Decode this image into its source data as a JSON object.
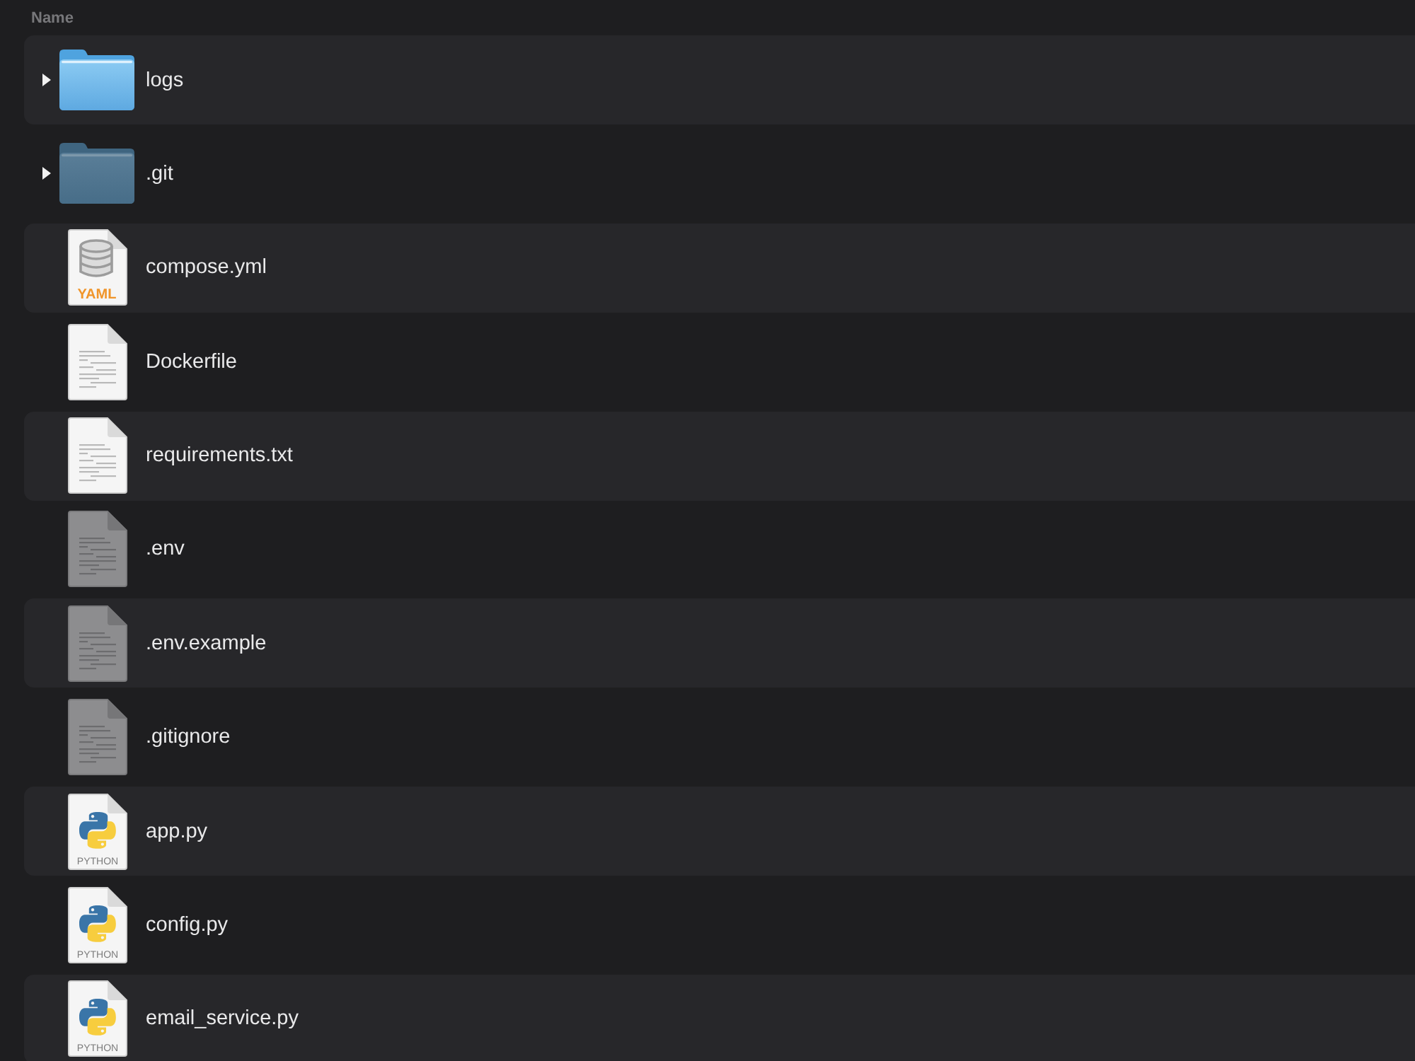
{
  "table": {
    "columns": [
      "Name"
    ],
    "rows": [
      {
        "name": "logs",
        "kind": "folder",
        "expanded": false,
        "hidden": false
      },
      {
        "name": ".git",
        "kind": "folder",
        "expanded": false,
        "hidden": true
      },
      {
        "name": "compose.yml",
        "kind": "yaml",
        "badge": "YAML",
        "hidden": false
      },
      {
        "name": "Dockerfile",
        "kind": "text",
        "hidden": false
      },
      {
        "name": "requirements.txt",
        "kind": "text",
        "hidden": false
      },
      {
        "name": ".env",
        "kind": "text",
        "hidden": true
      },
      {
        "name": ".env.example",
        "kind": "text",
        "hidden": true
      },
      {
        "name": ".gitignore",
        "kind": "text",
        "hidden": true
      },
      {
        "name": "app.py",
        "kind": "python",
        "badge": "PYTHON",
        "hidden": false
      },
      {
        "name": "config.py",
        "kind": "python",
        "badge": "PYTHON",
        "hidden": false
      },
      {
        "name": "email_service.py",
        "kind": "python",
        "badge": "PYTHON",
        "hidden": false
      }
    ]
  }
}
